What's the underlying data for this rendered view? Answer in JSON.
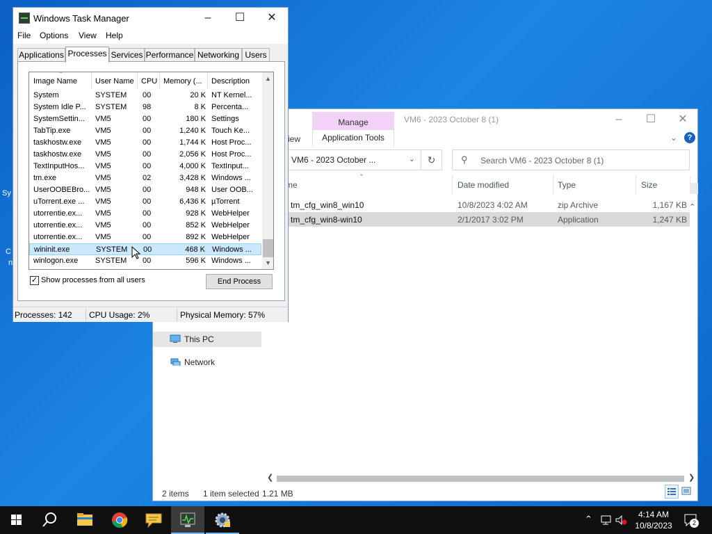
{
  "explorer": {
    "title": "VM6 - 2023 October 8 (1)",
    "ribbon_manage": "Manage",
    "ribbon_app_tools": "Application Tools",
    "ribbon_view": "iew",
    "address": "VM6 - 2023 October ...",
    "search_placeholder": "Search VM6 - 2023 October 8 (1)",
    "columns": {
      "name": "me",
      "date": "Date modified",
      "type": "Type",
      "size": "Size"
    },
    "files": [
      {
        "name": "tm_cfg_win8_win10",
        "date": "10/8/2023 4:02 AM",
        "type": "zip Archive",
        "size": "1,167 KB"
      },
      {
        "name": "tm_cfg_win8-win10",
        "date": "2/1/2017 3:02 PM",
        "type": "Application",
        "size": "1,247 KB"
      }
    ],
    "nav": {
      "this_pc": "This PC",
      "network": "Network"
    },
    "status": {
      "items": "2 items",
      "selected": "1 item selected",
      "size": "1.21 MB"
    }
  },
  "taskmgr": {
    "title": "Windows Task Manager",
    "menu": [
      "File",
      "Options",
      "View",
      "Help"
    ],
    "tabs": [
      "Applications",
      "Processes",
      "Services",
      "Performance",
      "Networking",
      "Users"
    ],
    "active_tab": "Processes",
    "columns": [
      "Image Name",
      "User Name",
      "CPU",
      "Memory (...",
      "Description"
    ],
    "rows": [
      [
        "System",
        "SYSTEM",
        "00",
        "20 K",
        "NT Kernel..."
      ],
      [
        "System Idle P...",
        "SYSTEM",
        "98",
        "8 K",
        "Percenta..."
      ],
      [
        "SystemSettin...",
        "VM5",
        "00",
        "180 K",
        "Settings"
      ],
      [
        "TabTip.exe",
        "VM5",
        "00",
        "1,240 K",
        "Touch Ke..."
      ],
      [
        "taskhostw.exe",
        "VM5",
        "00",
        "1,744 K",
        "Host Proc..."
      ],
      [
        "taskhostw.exe",
        "VM5",
        "00",
        "2,056 K",
        "Host Proc..."
      ],
      [
        "TextInputHos...",
        "VM5",
        "00",
        "4,000 K",
        "TextInput..."
      ],
      [
        "tm.exe",
        "VM5",
        "02",
        "3,428 K",
        "Windows ..."
      ],
      [
        "UserOOBEBro...",
        "VM5",
        "00",
        "948 K",
        "User OOB..."
      ],
      [
        "uTorrent.exe ...",
        "VM5",
        "00",
        "6,436 K",
        "µTorrent"
      ],
      [
        "utorrentie.ex...",
        "VM5",
        "00",
        "928 K",
        "WebHelper"
      ],
      [
        "utorrentie.ex...",
        "VM5",
        "00",
        "852 K",
        "WebHelper"
      ],
      [
        "utorrentie.ex...",
        "VM5",
        "00",
        "892 K",
        "WebHelper"
      ],
      [
        "wininit.exe",
        "SYSTEM",
        "00",
        "468 K",
        "Windows ..."
      ],
      [
        "winlogon.exe",
        "SYSTEM",
        "00",
        "596 K",
        "Windows ..."
      ]
    ],
    "selected_row": 13,
    "show_all_label": "Show processes from all users",
    "show_all_checked": "✓",
    "end_process": "End Process",
    "status": {
      "processes": "Processes: 142",
      "cpu": "CPU Usage: 2%",
      "memory": "Physical Memory: 57%"
    }
  },
  "desktop_fragments": [
    "Sy",
    "C",
    "n"
  ],
  "taskbar": {
    "time": "4:14 AM",
    "date": "10/8/2023",
    "notification_count": "2"
  }
}
